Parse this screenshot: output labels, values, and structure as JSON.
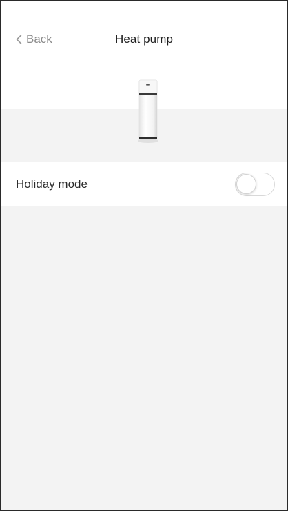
{
  "header": {
    "back_label": "Back",
    "title": "Heat pump"
  },
  "device": {
    "icon": "heat-pump-unit-icon"
  },
  "settings": {
    "holiday_mode": {
      "label": "Holiday mode",
      "enabled": false
    }
  },
  "colors": {
    "background": "#f3f3f3",
    "surface": "#ffffff",
    "muted_text": "#8b8b8b",
    "toggle_border": "#d8d8d8"
  }
}
